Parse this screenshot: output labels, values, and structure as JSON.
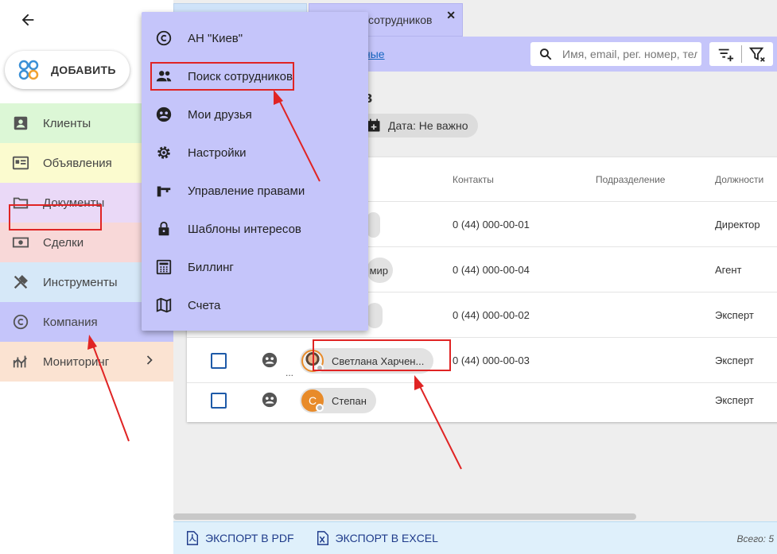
{
  "sidebar": {
    "add_label": "ДОБАВИТЬ",
    "items": [
      {
        "label": "Клиенты",
        "icon": "contacts-icon",
        "bg": "#dcf7d6"
      },
      {
        "label": "Объявления",
        "icon": "listing-icon",
        "bg": "#fbfbcf"
      },
      {
        "label": "Документы",
        "icon": "folder-icon",
        "bg": "#ead9f7"
      },
      {
        "label": "Сделки",
        "icon": "money-icon",
        "bg": "#f8d8d8"
      },
      {
        "label": "Инструменты",
        "icon": "tools-icon",
        "bg": "#d6e8f8"
      },
      {
        "label": "Компания",
        "icon": "copyright-icon",
        "bg": "#c5c5fa"
      },
      {
        "label": "Мониторинг",
        "icon": "monitoring-icon",
        "bg": "#fbe3d2"
      }
    ]
  },
  "tabs": {
    "active_label": "сотрудников"
  },
  "toolbar": {
    "link_label": "ные",
    "search_placeholder": "Имя, email, рег. номер, тел"
  },
  "page": {
    "heading": "в",
    "filter_label": "Дата: Не важно"
  },
  "table": {
    "headers": {
      "contacts": "Контакты",
      "division": "Подразделение",
      "positions": "Должности"
    },
    "rows": [
      {
        "name": "",
        "contact": "0 (44) 000-00-01",
        "position": "Директор"
      },
      {
        "name": "мир",
        "contact": "0 (44) 000-00-04",
        "position": "Агент"
      },
      {
        "name": "м",
        "contact": "0 (44) 000-00-02",
        "position": "Эксперт"
      },
      {
        "name": "Светлана Харчен...",
        "contact": "0 (44) 000-00-03",
        "position": "Эксперт",
        "avatar": "photo"
      },
      {
        "name": "Степан",
        "contact": "",
        "position": "Эксперт",
        "avatar": "С"
      }
    ],
    "more": "..."
  },
  "footer": {
    "pdf_label": "ЭКСПОРТ В PDF",
    "excel_label": "ЭКСПОРТ В EXCEL",
    "total": "Всего: 5"
  },
  "menu": {
    "items": [
      {
        "label": "АН \"Киев\"",
        "icon": "copyright-icon"
      },
      {
        "label": "Поиск сотрудников",
        "icon": "people-icon"
      },
      {
        "label": "Мои друзья",
        "icon": "friends-icon"
      },
      {
        "label": "Настройки",
        "icon": "gear-icon"
      },
      {
        "label": "Управление правами",
        "icon": "key-icon"
      },
      {
        "label": "Шаблоны интересов",
        "icon": "lock-icon"
      },
      {
        "label": "Биллинг",
        "icon": "calculator-icon"
      },
      {
        "label": "Счета",
        "icon": "map-icon"
      }
    ]
  },
  "colors": {
    "accent": "#c5c5fa",
    "highlight": "#e02424",
    "link": "#1565c0"
  }
}
